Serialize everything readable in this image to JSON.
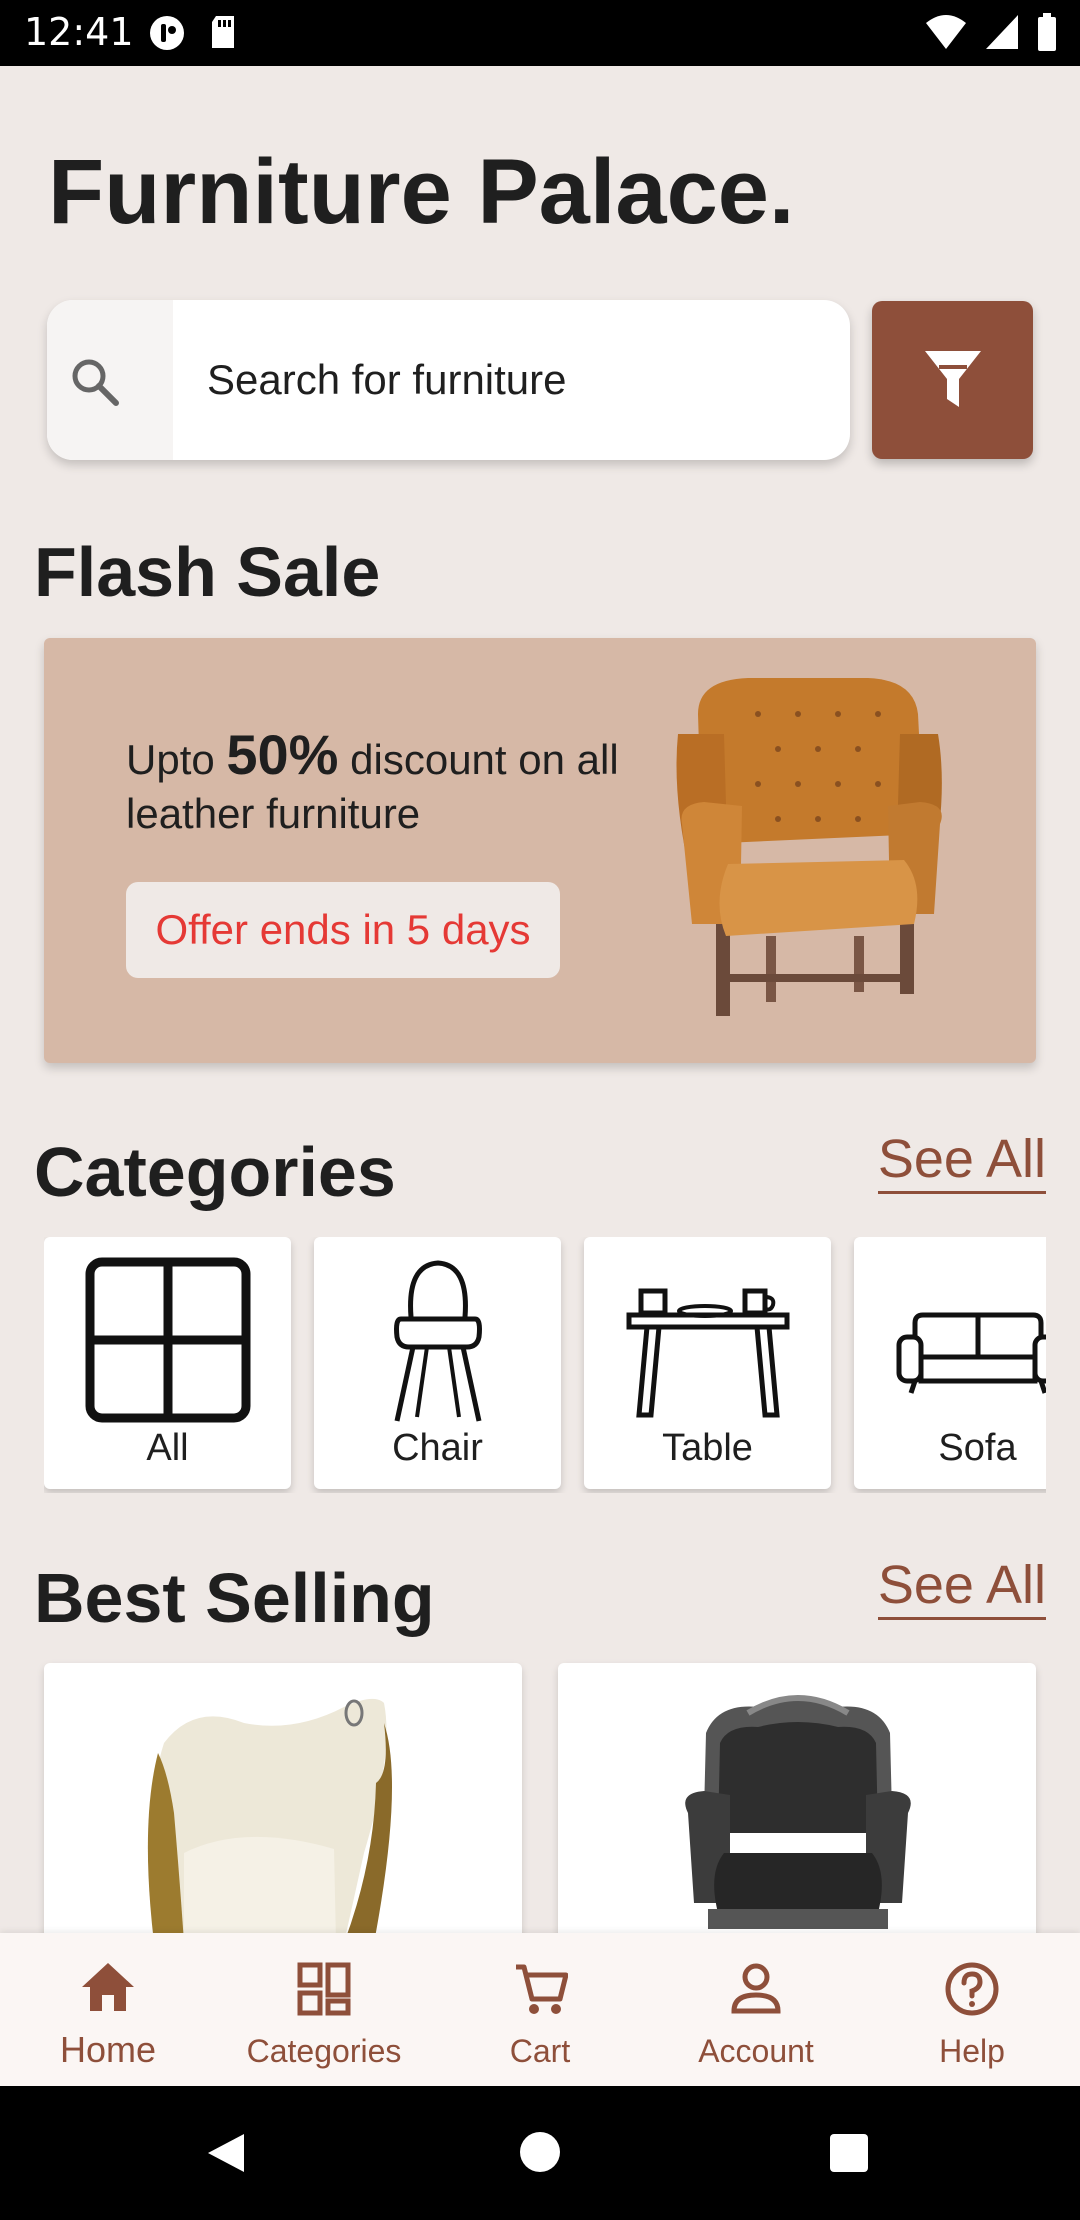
{
  "status_bar": {
    "time": "12:41"
  },
  "app": {
    "title": "Furniture Palace."
  },
  "search": {
    "placeholder": "Search for furniture"
  },
  "flash_sale": {
    "heading": "Flash Sale",
    "text_prefix": "Upto ",
    "discount": "50%",
    "text_suffix": " discount on all leather furniture",
    "offer_badge": "Offer ends in 5 days"
  },
  "categories": {
    "heading": "Categories",
    "see_all": "See All",
    "items": [
      {
        "label": "All",
        "icon": "grid-icon"
      },
      {
        "label": "Chair",
        "icon": "chair-icon"
      },
      {
        "label": "Table",
        "icon": "table-icon"
      },
      {
        "label": "Sofa",
        "icon": "sofa-icon"
      }
    ]
  },
  "best_selling": {
    "heading": "Best Selling",
    "see_all": "See All"
  },
  "bottom_nav": {
    "items": [
      {
        "label": "Home",
        "icon": "home-icon",
        "active": true
      },
      {
        "label": "Categories",
        "icon": "categories-icon"
      },
      {
        "label": "Cart",
        "icon": "cart-icon"
      },
      {
        "label": "Account",
        "icon": "account-icon"
      },
      {
        "label": "Help",
        "icon": "help-icon"
      }
    ]
  },
  "colors": {
    "accent": "#8e4f3a",
    "background": "#efe9e6",
    "banner": "#d6b8a6",
    "offer_text": "#e53935"
  }
}
